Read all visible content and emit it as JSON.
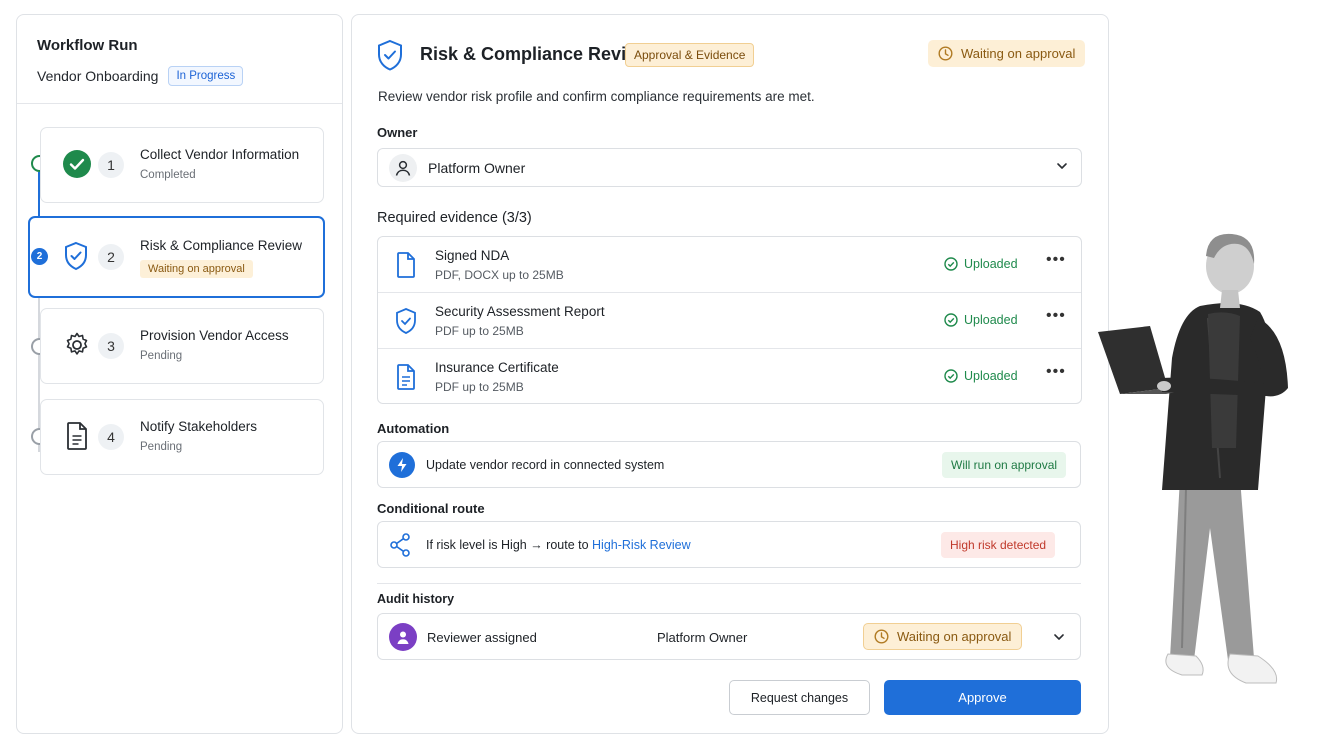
{
  "workflow": {
    "title": "Workflow Run",
    "name": "Vendor Onboarding",
    "status": "In Progress"
  },
  "steps": [
    {
      "number": "1",
      "title": "Collect Vendor Information",
      "status": "Completed",
      "icon": "check-circle-icon"
    },
    {
      "number": "2",
      "title": "Risk & Compliance Review",
      "status": "Waiting on approval",
      "icon": "shield-check-icon"
    },
    {
      "number": "3",
      "title": "Provision Vendor Access",
      "status": "Pending",
      "icon": "gear-icon"
    },
    {
      "number": "4",
      "title": "Notify Stakeholders",
      "status": "Pending",
      "icon": "document-icon"
    }
  ],
  "detail": {
    "title": "Risk & Compliance Review",
    "tag": "Approval & Evidence",
    "status": "Waiting on approval",
    "description": "Review vendor risk profile and confirm compliance requirements are met.",
    "owner_label": "Owner",
    "owner_value": "Platform Owner",
    "evidence_label": "Required evidence (3/3)",
    "evidence": [
      {
        "name": "Signed NDA",
        "desc": "PDF, DOCX up to 25MB",
        "status": "Uploaded",
        "icon": "file-icon"
      },
      {
        "name": "Security Assessment Report",
        "desc": "PDF up to 25MB",
        "status": "Uploaded",
        "icon": "shield-check-icon"
      },
      {
        "name": "Insurance Certificate",
        "desc": "PDF up to 25MB",
        "status": "Uploaded",
        "icon": "document-icon"
      }
    ],
    "automation_label": "Automation",
    "automation_text": "Update vendor record in connected system",
    "automation_status": "Will run on approval",
    "route_label": "Conditional route",
    "route_prefix": "If risk level is High → route to ",
    "route_link": "High-Risk Review",
    "route_status": "High risk detected",
    "audit_label": "Audit history",
    "audit_event": "Reviewer assigned",
    "audit_actor": "Platform Owner",
    "audit_status": "Waiting on approval",
    "request_changes": "Request changes",
    "approve": "Approve"
  },
  "colors": {
    "accent": "#1f6fd9",
    "success": "#1f8a4c",
    "warning_bg": "#fdefd6",
    "danger": "#c0392b",
    "audit_avatar": "#7b3fc4"
  }
}
